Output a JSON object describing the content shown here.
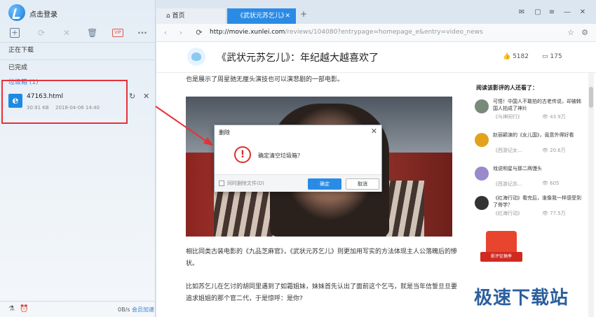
{
  "app": {
    "login_label": "点击登录"
  },
  "left_panel": {
    "nav": {
      "downloading": "正在下载",
      "completed": "已完成",
      "trash": "垃圾箱 (1)"
    },
    "file": {
      "name": "47163.html",
      "size": "30.91 KB",
      "date": "2018-04-06 14:40",
      "icon_letter": "e"
    },
    "toolbar": {
      "vip": "VIP"
    },
    "bottom": {
      "speed": "0B/s",
      "vip_speed": "会员加速"
    }
  },
  "browser": {
    "tabs": [
      {
        "label": "首页"
      },
      {
        "label": "《武状元苏乞儿》"
      }
    ],
    "url_main": "http://movie.xunlei.com",
    "url_rest": "/reviews/104080?entrypage=homepage_e&entry=video_news",
    "article_title": "《武状元苏乞儿》：年纪越大越喜欢了",
    "likes": "5182",
    "comments": "175",
    "paragraphs": [
      "也是展示了周星驰无厘头演技也可以演悲剧的一部电影。",
      "相比同类古装电影的《九品芝麻官》，《武状元苏乞儿》则更加用写实的方法体现主人公落魄后的惨状。",
      "比如苏乞儿在乞讨的胡同里遇到了如霜姐妹，妹妹首先认出了面前这个乞丐，就是当年信誓旦旦要追求姐姐的那个官二代，于是惊呼：是你?"
    ]
  },
  "sidebar": {
    "title": "阅读该影评的人还看了：",
    "items": [
      {
        "title": "可悟！中国人不敢拍的古老传说，却被韩国人拍成了神片",
        "source": "《与神同行》",
        "views": "43.9万",
        "color": "#7a8a7a"
      },
      {
        "title": "赵丽颖演的《女儿国》，竟意外得好看",
        "source": "《西游记女…",
        "views": "20.6万",
        "color": "#e2a21b"
      },
      {
        "title": "戏说明星与那二两馒头",
        "source": "《西游记苏…",
        "views": "605",
        "color": "#9a8acb"
      },
      {
        "title": "《红海行动》看完后，谁像我一样感受到了骨学？",
        "source": "《红海行动》",
        "views": "77.5万",
        "color": "#333"
      }
    ],
    "badge": "影评征稿季"
  },
  "dialog": {
    "title": "删除",
    "message": "确定清空垃圾箱？",
    "checkbox_label": "同时删除文件(D)",
    "ok": "确定",
    "cancel": "取消"
  },
  "watermark": "极速下载站",
  "colors": {
    "accent": "#2a8be6",
    "highlight": "#e8303a",
    "warning": "#d9302c"
  }
}
